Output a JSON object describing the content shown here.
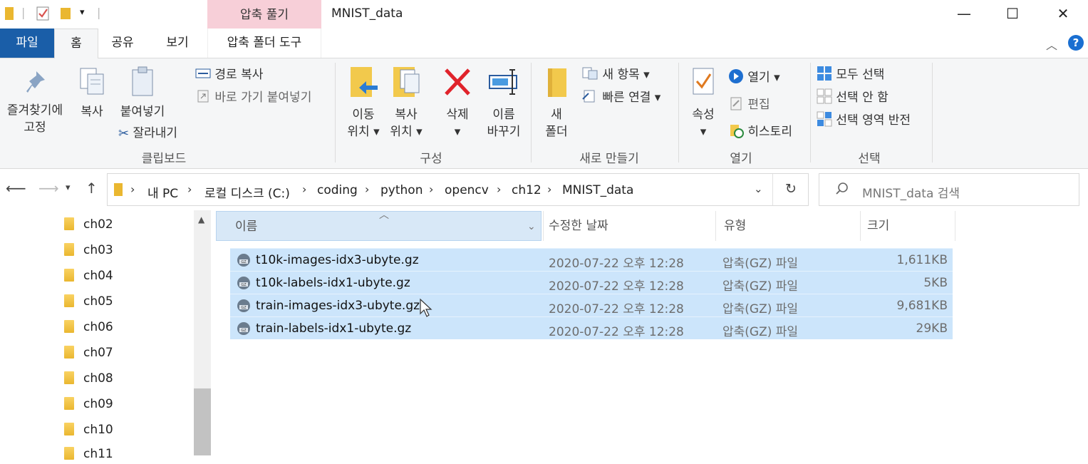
{
  "window": {
    "title": "MNIST_data",
    "context_tab": "압축 풀기",
    "buttons": {
      "minimize": "—",
      "maximize": "☐",
      "close": "✕"
    }
  },
  "tabs": {
    "file": "파일",
    "home": "홈",
    "share": "공유",
    "view": "보기",
    "zip_tools": "압축 폴더 도구"
  },
  "ribbon": {
    "clipboard": {
      "pin_line1": "즐겨찾기에",
      "pin_line2": "고정",
      "copy": "복사",
      "paste": "붙여넣기",
      "copy_path": "경로 복사",
      "paste_shortcut": "바로 가기 붙여넣기",
      "cut": "잘라내기",
      "label": "클립보드"
    },
    "organize": {
      "move_line1": "이동",
      "move_line2": "위치 ▾",
      "copyto_line1": "복사",
      "copyto_line2": "위치 ▾",
      "delete_line1": "삭제",
      "delete_line2": "▾",
      "rename_line1": "이름",
      "rename_line2": "바꾸기",
      "label": "구성"
    },
    "new": {
      "folder_line1": "새",
      "folder_line2": "폴더",
      "new_item": "새 항목 ▾",
      "easy_access": "빠른 연결 ▾",
      "label": "새로 만들기"
    },
    "open": {
      "properties_line1": "속성",
      "properties_line2": "▾",
      "open": "열기 ▾",
      "edit": "편집",
      "history": "히스토리",
      "label": "열기"
    },
    "select": {
      "select_all": "모두 선택",
      "select_none": "선택 안 함",
      "invert": "선택 영역 반전",
      "label": "선택"
    }
  },
  "address": {
    "crumbs": [
      "내 PC",
      "로컬 디스크 (C:)",
      "coding",
      "python",
      "opencv",
      "ch12",
      "MNIST_data"
    ],
    "search_placeholder": "MNIST_data 검색"
  },
  "sidebar": {
    "items": [
      "ch02",
      "ch03",
      "ch04",
      "ch05",
      "ch06",
      "ch07",
      "ch08",
      "ch09",
      "ch10",
      "ch11"
    ]
  },
  "columns": {
    "name": "이름",
    "date": "수정한 날짜",
    "type": "유형",
    "size": "크기"
  },
  "files": [
    {
      "name": "t10k-images-idx3-ubyte.gz",
      "date": "2020-07-22 오후 12:28",
      "type": "압축(GZ) 파일",
      "size": "1,611KB"
    },
    {
      "name": "t10k-labels-idx1-ubyte.gz",
      "date": "2020-07-22 오후 12:28",
      "type": "압축(GZ) 파일",
      "size": "5KB"
    },
    {
      "name": "train-images-idx3-ubyte.gz",
      "date": "2020-07-22 오후 12:28",
      "type": "압축(GZ) 파일",
      "size": "9,681KB"
    },
    {
      "name": "train-labels-idx1-ubyte.gz",
      "date": "2020-07-22 오후 12:28",
      "type": "압축(GZ) 파일",
      "size": "29KB"
    }
  ],
  "colors": {
    "file_tab": "#1a5ea8",
    "selection": "#cce5fb",
    "context_tab": "#f7cfd8"
  }
}
